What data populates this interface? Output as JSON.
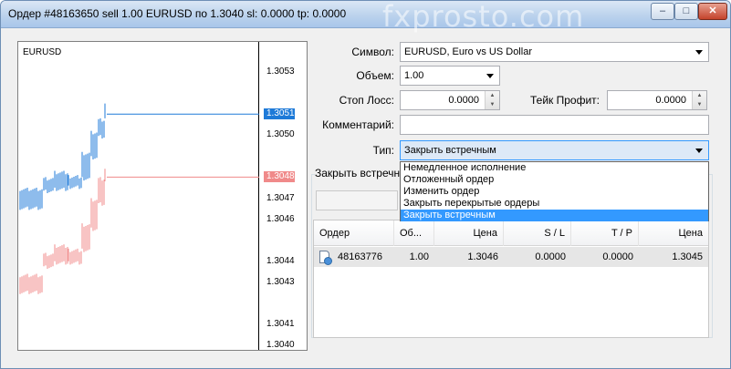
{
  "window": {
    "title": "Ордер #48163650 sell 1.00 EURUSD по 1.3040 sl: 0.0000 tp: 0.0000",
    "watermark": "fxprosto.com",
    "minimize_label": "‒",
    "maximize_label": "□",
    "close_label": "✕"
  },
  "chart": {
    "symbol": "EURUSD",
    "price_levels": [
      "1.3053",
      "1.3051",
      "1.3050",
      "1.3048",
      "1.3047",
      "1.3046",
      "1.3044",
      "1.3043",
      "1.3041",
      "1.3040"
    ],
    "ask": {
      "value": "1.3051",
      "color": "#1e7ad8"
    },
    "bid": {
      "value": "1.3048",
      "color": "#f08a8a"
    }
  },
  "form": {
    "symbol_label": "Символ:",
    "symbol_value": "EURUSD, Euro vs US Dollar",
    "volume_label": "Объем:",
    "volume_value": "1.00",
    "stoploss_label": "Стоп Лосс:",
    "stoploss_value": "0.0000",
    "takeprofit_label": "Тейк Профит:",
    "takeprofit_value": "0.0000",
    "comment_label": "Комментарий:",
    "comment_value": "",
    "type_label": "Тип:",
    "type_value": "Закрыть встречным",
    "section_label": "Закрыть встречн"
  },
  "type_options": [
    "Немедленное исполнение",
    "Отложенный ордер",
    "Изменить ордер",
    "Закрыть перекрытые ордеры",
    "Закрыть встречным"
  ],
  "grid": {
    "headers": [
      "Ордер",
      "Об...",
      "Цена",
      "S / L",
      "T / P",
      "Цена"
    ],
    "rows": [
      {
        "order": "48163776",
        "volume": "1.00",
        "price": "1.3046",
        "sl": "0.0000",
        "tp": "0.0000",
        "current": "1.3045"
      }
    ]
  }
}
